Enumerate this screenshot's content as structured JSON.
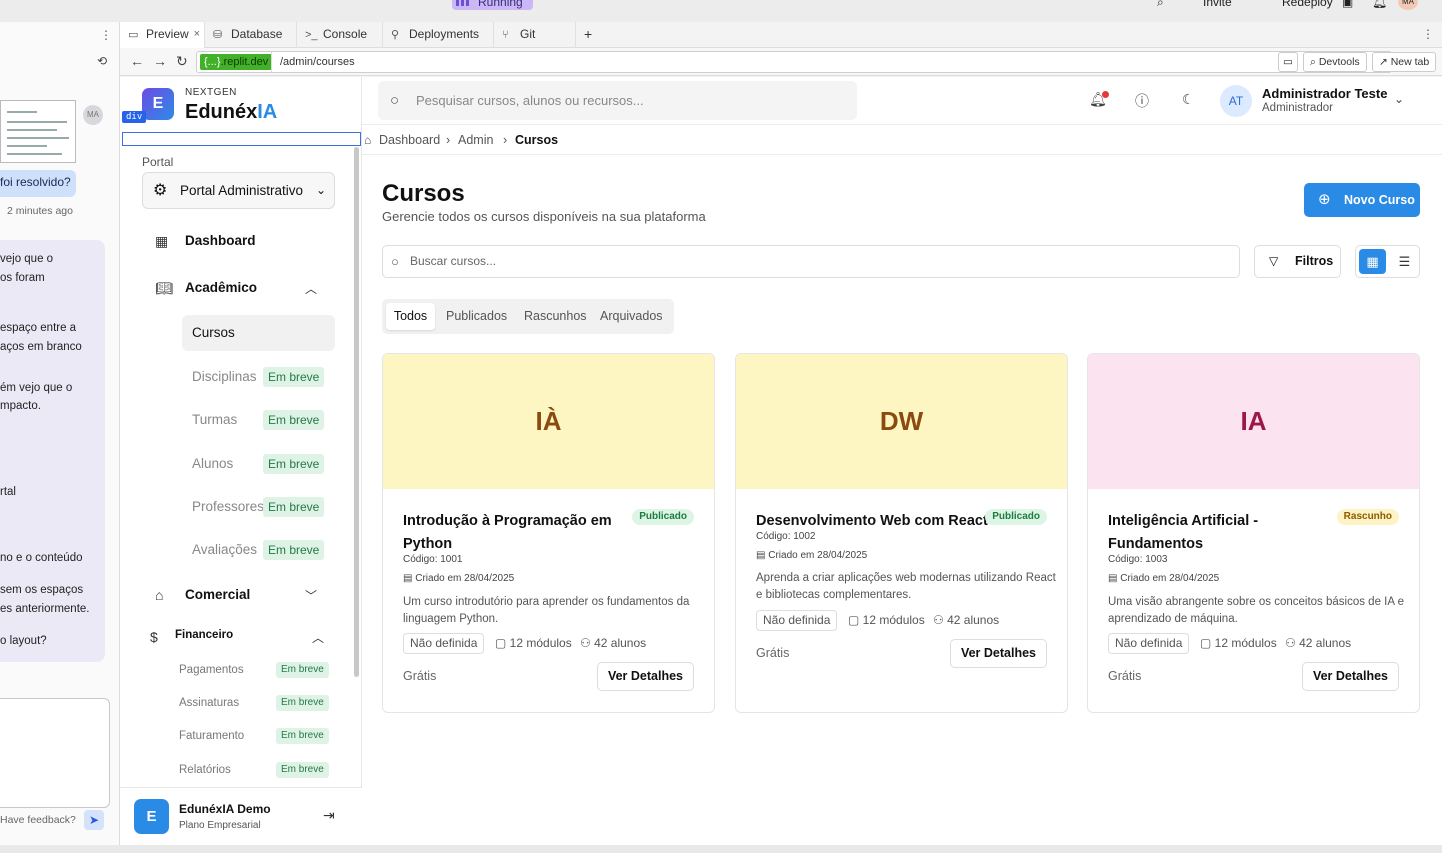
{
  "top": {
    "running": "Running",
    "invite": "Invite",
    "redeploy": "Redeploy",
    "user_initials": "MA"
  },
  "chat": {
    "avatar": "MA",
    "question": "foi resolvido?",
    "time": "2 minutes ago",
    "lines": [
      "vejo que o",
      "os foram",
      "espaço entre a",
      "aços em branco",
      "ém vejo que o",
      "mpacto.",
      "rtal",
      "no e o conteúdo",
      "sem os espaços",
      "es anteriormente.",
      "o layout?"
    ],
    "feedback": "Have feedback?"
  },
  "tabs": [
    {
      "label": "Preview",
      "icon": "monitor-icon"
    },
    {
      "label": "Database",
      "icon": "database-icon"
    },
    {
      "label": "Console",
      "icon": "terminal-icon"
    },
    {
      "label": "Deployments",
      "icon": "deploy-icon"
    },
    {
      "label": "Git",
      "icon": "git-icon"
    }
  ],
  "address": {
    "host_prefix": "{...}",
    "host": ".replit.dev",
    "path": "/admin/courses",
    "devtools": "Devtools",
    "newtab": "New tab"
  },
  "brand": {
    "subtitle": "NEXTGEN",
    "name_a": "Edunéx",
    "name_b": "IA",
    "logo_letter": "E",
    "div_tag": "div"
  },
  "sidebar": {
    "portal_label": "Portal",
    "portal_value": "Portal Administrativo",
    "dashboard": "Dashboard",
    "academico": "Acadêmico",
    "cursos": "Cursos",
    "academic_items": [
      {
        "label": "Disciplinas",
        "badge": "Em breve"
      },
      {
        "label": "Turmas",
        "badge": "Em breve"
      },
      {
        "label": "Alunos",
        "badge": "Em breve"
      },
      {
        "label": "Professores",
        "badge": "Em breve"
      },
      {
        "label": "Avaliações",
        "badge": "Em breve"
      }
    ],
    "comercial": "Comercial",
    "financeiro": "Financeiro",
    "finance_items": [
      {
        "label": "Pagamentos",
        "badge": "Em breve"
      },
      {
        "label": "Assinaturas",
        "badge": "Em breve"
      },
      {
        "label": "Faturamento",
        "badge": "Em breve"
      },
      {
        "label": "Relatórios",
        "badge": "Em breve"
      }
    ],
    "footer_name": "EdunéxIA Demo",
    "footer_plan": "Plano Empresarial",
    "footer_letter": "E"
  },
  "header": {
    "search_placeholder": "Pesquisar cursos, alunos ou recursos...",
    "avatar": "AT",
    "user_name": "Administrador Teste",
    "user_role": "Administrador"
  },
  "breadcrumb": [
    "Dashboard",
    "Admin",
    "Cursos"
  ],
  "page": {
    "title": "Cursos",
    "subtitle": "Gerencie todos os cursos disponíveis na sua plataforma",
    "new_button": "Novo Curso",
    "search_placeholder": "Buscar cursos...",
    "filters": "Filtros",
    "filter_tabs": [
      "Todos",
      "Publicados",
      "Rascunhos",
      "Arquivados"
    ]
  },
  "courses": [
    {
      "initials": "IÀ",
      "banner_color": "#fdf6c3",
      "text_color": "#8a4b0f",
      "title": "Introdução à Programação em Python",
      "status": "Publicado",
      "code": "Código: 1001",
      "created": "Criado em 28/04/2025",
      "description": "Um curso introdutório para aprender os fundamentos da linguagem Python.",
      "level": "Não definida",
      "modules": "12 módulos",
      "students": "42 alunos",
      "price": "Grátis",
      "action": "Ver Detalhes"
    },
    {
      "initials": "DW",
      "banner_color": "#fdf6c3",
      "text_color": "#8a4b0f",
      "title": "Desenvolvimento Web com React",
      "status": "Publicado",
      "code": "Código: 1002",
      "created": "Criado em 28/04/2025",
      "description": "Aprenda a criar aplicações web modernas utilizando React e bibliotecas complementares.",
      "level": "Não definida",
      "modules": "12 módulos",
      "students": "42 alunos",
      "price": "Grátis",
      "action": "Ver Detalhes"
    },
    {
      "initials": "IA",
      "banner_color": "#fbe4f0",
      "text_color": "#9d1749",
      "title": "Inteligência Artificial - Fundamentos",
      "status": "Rascunho",
      "code": "Código: 1003",
      "created": "Criado em 28/04/2025",
      "description": "Uma visão abrangente sobre os conceitos básicos de IA e aprendizado de máquina.",
      "level": "Não definida",
      "modules": "12 módulos",
      "students": "42 alunos",
      "price": "Grátis",
      "action": "Ver Detalhes"
    }
  ]
}
